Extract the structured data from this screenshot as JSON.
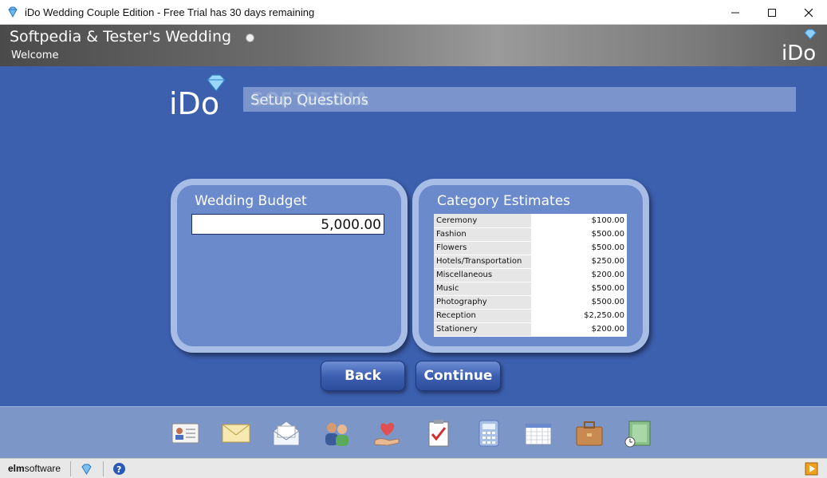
{
  "window": {
    "title": "iDo Wedding Couple Edition - Free Trial has 30 days remaining"
  },
  "header": {
    "wedding_title": "Softpedia & Tester's Wedding",
    "subtitle": "Welcome",
    "logo_text": "iDo"
  },
  "setup": {
    "logo_text": "iDo",
    "title": "Setup Questions",
    "watermark": "SOFTPEDIA"
  },
  "budget": {
    "heading": "Wedding Budget",
    "value": "5,000.00"
  },
  "estimates": {
    "heading": "Category Estimates",
    "rows": [
      {
        "category": "Ceremony",
        "amount": "$100.00"
      },
      {
        "category": "Fashion",
        "amount": "$500.00"
      },
      {
        "category": "Flowers",
        "amount": "$500.00"
      },
      {
        "category": "Hotels/Transportation",
        "amount": "$250.00"
      },
      {
        "category": "Miscellaneous",
        "amount": "$200.00"
      },
      {
        "category": "Music",
        "amount": "$500.00"
      },
      {
        "category": "Photography",
        "amount": "$500.00"
      },
      {
        "category": "Reception",
        "amount": "$2,250.00"
      },
      {
        "category": "Stationery",
        "amount": "$200.00"
      }
    ]
  },
  "buttons": {
    "back": "Back",
    "continue": "Continue"
  },
  "toolbar": {
    "icons": [
      "contact-card-icon",
      "envelope-icon",
      "open-envelope-icon",
      "guests-icon",
      "heart-hand-icon",
      "checklist-icon",
      "calculator-icon",
      "calendar-icon",
      "briefcase-icon",
      "ledger-clock-icon"
    ]
  },
  "statusbar": {
    "brand_bold": "elm",
    "brand_rest": "software"
  },
  "colors": {
    "main_bg": "#3c5fae",
    "panel_border": "#a8bde6",
    "panel_inner": "#6a8acc",
    "toolbar_bg": "#7d96c8"
  }
}
